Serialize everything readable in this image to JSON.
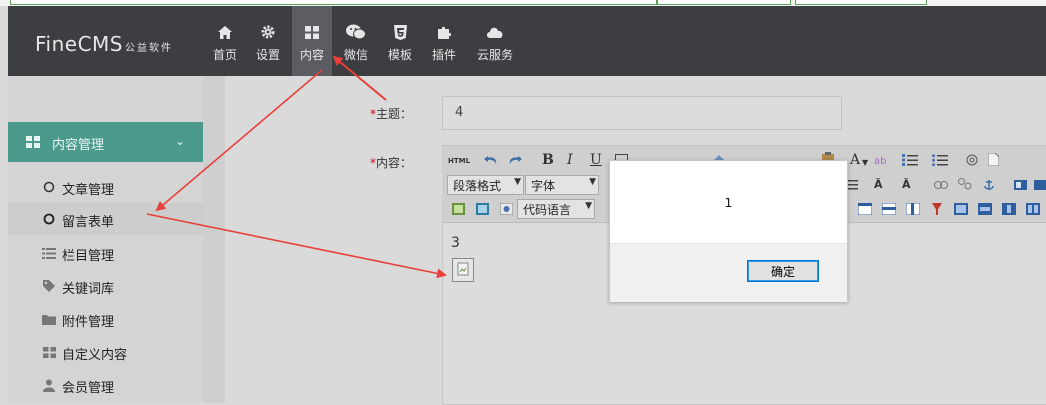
{
  "header": {
    "logo_main": "FineCMS",
    "logo_sub": "公益软件",
    "nav": [
      {
        "label": "首页",
        "icon": "home-icon"
      },
      {
        "label": "设置",
        "icon": "gear-icon"
      },
      {
        "label": "内容",
        "icon": "grid-icon",
        "active": true
      },
      {
        "label": "微信",
        "icon": "wechat-icon"
      },
      {
        "label": "模板",
        "icon": "html5-icon"
      },
      {
        "label": "插件",
        "icon": "puzzle-icon"
      },
      {
        "label": "云服务",
        "icon": "cloud-icon"
      }
    ]
  },
  "sidebar": {
    "group_label": "内容管理",
    "items": [
      {
        "label": "文章管理",
        "icon": "circle-icon"
      },
      {
        "label": "留言表单",
        "icon": "circle-icon",
        "active": true
      },
      {
        "label": "栏目管理",
        "icon": "list-icon"
      },
      {
        "label": "关键词库",
        "icon": "tag-icon"
      },
      {
        "label": "附件管理",
        "icon": "folder-icon"
      },
      {
        "label": "自定义内容",
        "icon": "grid-icon"
      },
      {
        "label": "会员管理",
        "icon": "user-icon"
      }
    ]
  },
  "form": {
    "required_mark": "*",
    "subject_label": "主题：",
    "subject_value": "4",
    "content_label": "内容：",
    "content_text": "3"
  },
  "toolbar": {
    "html_label": "HTML",
    "bold": "B",
    "italic": "I",
    "underline": "U",
    "paragraph_select": "段落格式",
    "font_select": "字体",
    "code_lang_select": "代码语言",
    "font_color": "A"
  },
  "dialog": {
    "message": "1",
    "ok_label": "确定"
  },
  "colors": {
    "header_bg": "#3d3e42",
    "sidebar_accent": "#4b9a8b",
    "annotation_arrow": "#e8403a",
    "dialog_button_border": "#0078d7"
  }
}
